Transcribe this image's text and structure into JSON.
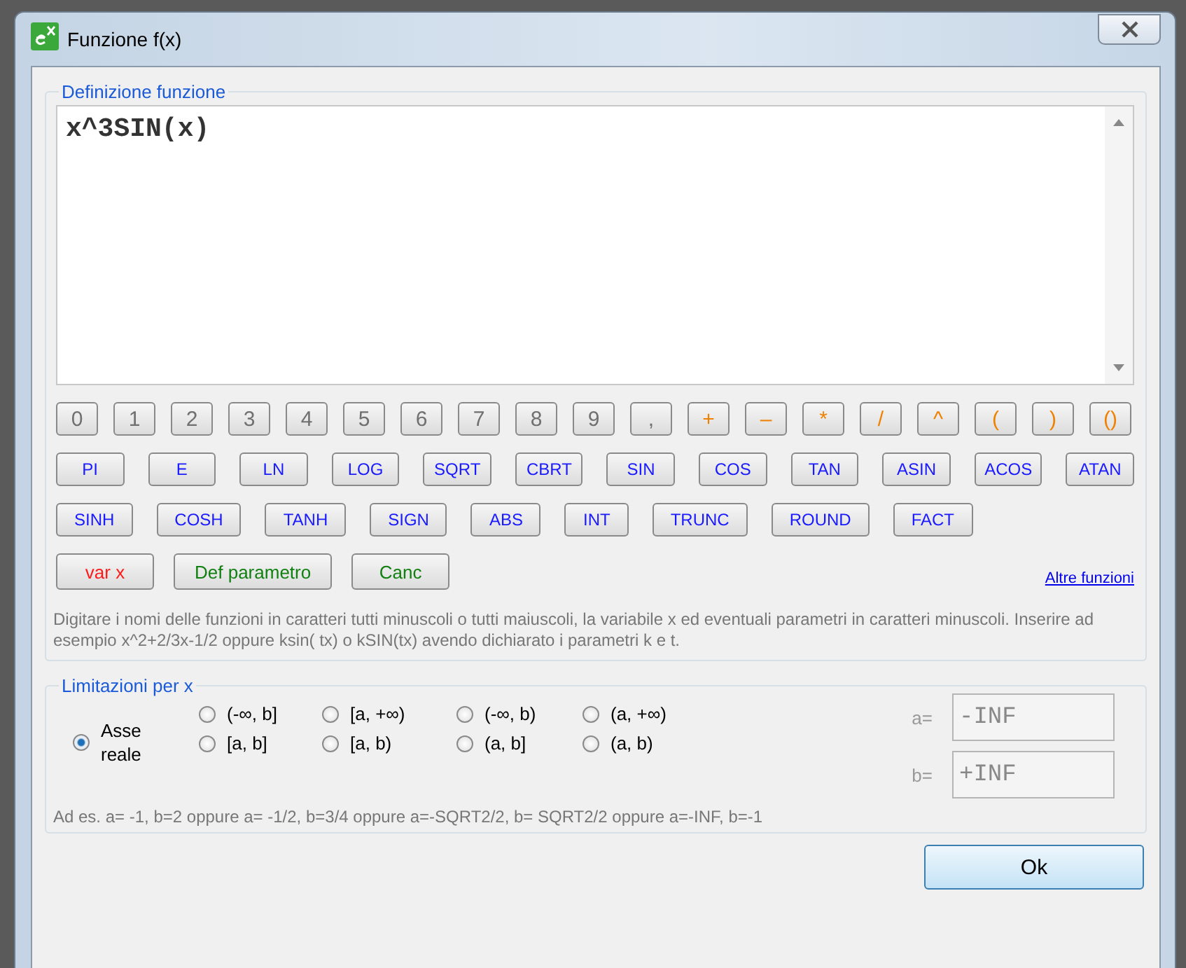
{
  "window": {
    "title": "Funzione f(x)"
  },
  "definition": {
    "legend": "Definizione funzione",
    "expression": "x^3SIN(x)",
    "key_rows": [
      [
        {
          "label": "0",
          "kind": "digit"
        },
        {
          "label": "1",
          "kind": "digit"
        },
        {
          "label": "2",
          "kind": "digit"
        },
        {
          "label": "3",
          "kind": "digit"
        },
        {
          "label": "4",
          "kind": "digit"
        },
        {
          "label": "5",
          "kind": "digit"
        },
        {
          "label": "6",
          "kind": "digit"
        },
        {
          "label": "7",
          "kind": "digit"
        },
        {
          "label": "8",
          "kind": "digit"
        },
        {
          "label": "9",
          "kind": "digit"
        },
        {
          "label": ",",
          "kind": "digit"
        },
        {
          "label": "+",
          "kind": "operator"
        },
        {
          "label": "–",
          "kind": "operator"
        },
        {
          "label": "*",
          "kind": "operator"
        },
        {
          "label": "/",
          "kind": "operator"
        },
        {
          "label": "^",
          "kind": "operator"
        },
        {
          "label": "(",
          "kind": "operator"
        },
        {
          "label": ")",
          "kind": "operator"
        },
        {
          "label": "()",
          "kind": "operator"
        }
      ],
      [
        {
          "label": "PI",
          "kind": "function"
        },
        {
          "label": "E",
          "kind": "function"
        },
        {
          "label": "LN",
          "kind": "function"
        },
        {
          "label": "LOG",
          "kind": "function"
        },
        {
          "label": "SQRT",
          "kind": "function"
        },
        {
          "label": "CBRT",
          "kind": "function"
        },
        {
          "label": "SIN",
          "kind": "function"
        },
        {
          "label": "COS",
          "kind": "function"
        },
        {
          "label": "TAN",
          "kind": "function"
        },
        {
          "label": "ASIN",
          "kind": "function"
        },
        {
          "label": "ACOS",
          "kind": "function"
        },
        {
          "label": "ATAN",
          "kind": "function"
        }
      ],
      [
        {
          "label": "SINH",
          "kind": "function"
        },
        {
          "label": "COSH",
          "kind": "function"
        },
        {
          "label": "TANH",
          "kind": "function"
        },
        {
          "label": "SIGN",
          "kind": "function"
        },
        {
          "label": "ABS",
          "kind": "function"
        },
        {
          "label": "INT",
          "kind": "function"
        },
        {
          "label": "TRUNC",
          "kind": "function"
        },
        {
          "label": "ROUND",
          "kind": "function"
        },
        {
          "label": "FACT",
          "kind": "function"
        }
      ],
      [
        {
          "label": "var x",
          "kind": "variable"
        },
        {
          "label": "Def parametro",
          "kind": "command"
        },
        {
          "label": "Canc",
          "kind": "command"
        }
      ]
    ],
    "more_link": "Altre funzioni",
    "help": "Digitare i nomi delle funzioni in caratteri tutti minuscoli o tutti maiuscoli, la variabile x ed eventuali parametri in caratteri minuscoli. Inserire ad esempio x^2+2/3x-1/2 oppure ksin( tx) o kSIN(tx) avendo dichiarato i parametri k e t."
  },
  "limits": {
    "legend": "Limitazioni per x",
    "real_axis": {
      "label": "Asse reale",
      "selected": true
    },
    "intervals": [
      {
        "label": "(-∞, b]",
        "selected": false
      },
      {
        "label": "[a, +∞)",
        "selected": false
      },
      {
        "label": "(-∞, b)",
        "selected": false
      },
      {
        "label": "(a, +∞)",
        "selected": false
      },
      {
        "label": "[a, b]",
        "selected": false
      },
      {
        "label": "[a, b)",
        "selected": false
      },
      {
        "label": "(a, b]",
        "selected": false
      },
      {
        "label": "(a, b)",
        "selected": false
      }
    ],
    "a": {
      "label": "a=",
      "value": "-INF"
    },
    "b": {
      "label": "b=",
      "value": "+INF"
    },
    "example": "Ad es. a= -1, b=2 oppure a= -1/2, b=3/4 oppure a=-SQRT2/2, b= SQRT2/2 oppure a=-INF, b=-1"
  },
  "buttons": [
    "Ok"
  ]
}
